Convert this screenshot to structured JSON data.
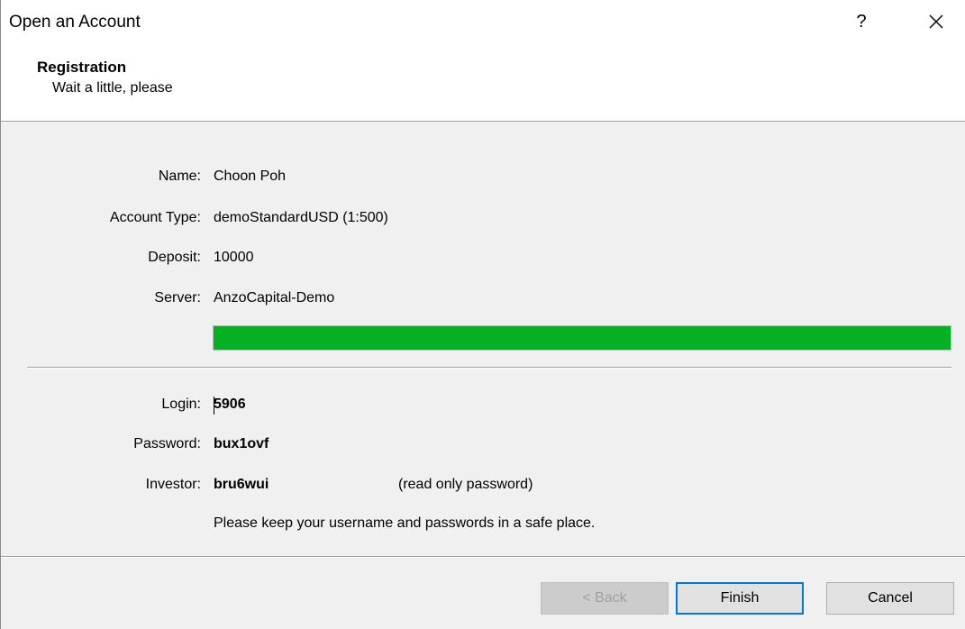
{
  "window": {
    "title": "Open an Account",
    "help_glyph": "?",
    "close_icon": "close-icon"
  },
  "header": {
    "title": "Registration",
    "subtitle": "Wait a little, please"
  },
  "details": {
    "name_label": "Name:",
    "name_value": "Choon Poh",
    "account_type_label": "Account Type:",
    "account_type_value": "demoStandardUSD (1:500)",
    "deposit_label": "Deposit:",
    "deposit_value": "10000",
    "server_label": "Server:",
    "server_value": "AnzoCapital-Demo"
  },
  "progress": {
    "fraction": 1.0,
    "color": "#06b025"
  },
  "credentials": {
    "login_label": "Login:",
    "login_value": "5906",
    "password_label": "Password:",
    "password_value": "bux1ovf",
    "investor_label": "Investor:",
    "investor_value": "bru6wui",
    "investor_note": "(read only password)",
    "notice": "Please keep your username and passwords in a safe place."
  },
  "buttons": {
    "back_label": "< Back",
    "finish_label": "Finish",
    "cancel_label": "Cancel"
  },
  "colors": {
    "focus_accent": "#0078d7"
  }
}
